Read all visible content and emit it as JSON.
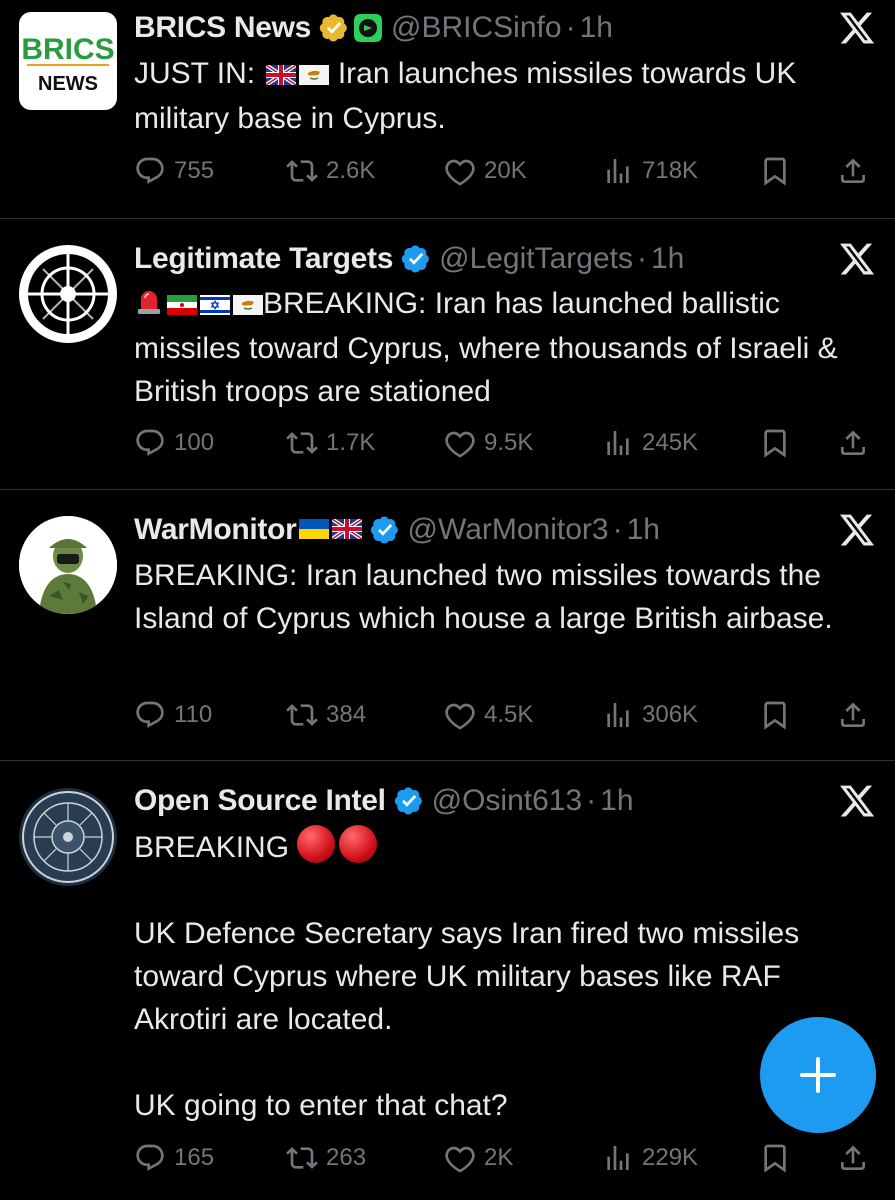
{
  "colors": {
    "background": "#000000",
    "text": "#e7e9ea",
    "muted": "#71767b",
    "accent": "#1d9bf0",
    "verified_gold": "#e8b830",
    "verified_blue": "#1d9bf0"
  },
  "tweets": [
    {
      "name": "BRICS News",
      "handle": "@BRICSinfo",
      "time": "1h",
      "avatar_text_top": "BRICS",
      "avatar_text_bottom": "NEWS",
      "text_prefix": "JUST IN:",
      "text": "Iran launches missiles towards UK military base in Cyprus.",
      "replies": "755",
      "reposts": "2.6K",
      "likes": "20K",
      "views": "718K"
    },
    {
      "name": "Legitimate Targets",
      "handle": "@LegitTargets",
      "time": "1h",
      "text_prefix": "BREAKING: Iran has launched ballistic",
      "text": "missiles toward Cyprus, where thousands of Israeli & British troops are stationed",
      "replies": "100",
      "reposts": "1.7K",
      "likes": "9.5K",
      "views": "245K"
    },
    {
      "name": "WarMonitor",
      "handle": "@WarMonitor3",
      "time": "1h",
      "text": "BREAKING: Iran launched two missiles towards the Island of Cyprus which house a large British airbase.",
      "replies": "110",
      "reposts": "384",
      "likes": "4.5K",
      "views": "306K"
    },
    {
      "name": "Open Source Intel",
      "handle": "@Osint613",
      "time": "1h",
      "text_line1": "BREAKING",
      "text_para2": "UK Defence Secretary says Iran fired two missiles toward Cyprus where UK military bases like RAF Akrotiri are located.",
      "text_para3": "UK going to enter that chat?",
      "replies": "165",
      "reposts": "263",
      "likes": "2K",
      "views": "229K"
    }
  ],
  "icons": [
    "verified-badge-icon",
    "x-logo-icon",
    "reply-icon",
    "repost-icon",
    "like-icon",
    "views-icon",
    "bookmark-icon",
    "share-icon",
    "plus-icon"
  ]
}
